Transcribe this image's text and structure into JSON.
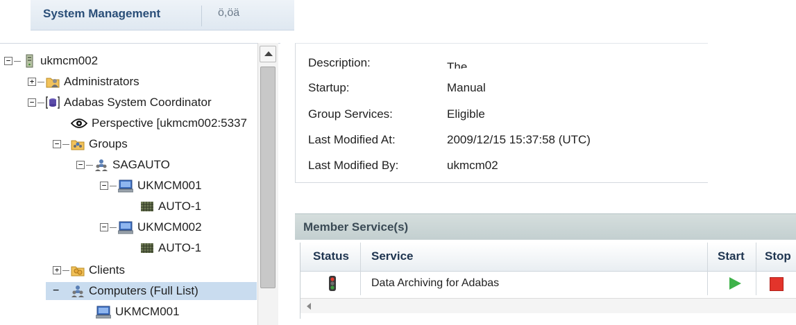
{
  "header": {
    "tab_label": "System Management",
    "tab2_label": "ö,öä"
  },
  "tree": {
    "items": [
      {
        "label": "ukmcm002"
      },
      {
        "label": "Administrators"
      },
      {
        "label": "Adabas System Coordinator"
      },
      {
        "label": "Perspective [ukmcm002:5337"
      },
      {
        "label": "Groups"
      },
      {
        "label": "SAGAUTO"
      },
      {
        "label": "UKMCM001"
      },
      {
        "label": "AUTO-1"
      },
      {
        "label": "UKMCM002"
      },
      {
        "label": "AUTO-1"
      },
      {
        "label": "Clients"
      },
      {
        "label": "Computers (Full List)"
      },
      {
        "label": "UKMCM001"
      }
    ],
    "toggles": {
      "expanded": "−",
      "collapsed": "+"
    }
  },
  "details": {
    "properties": [
      {
        "label": "Description:",
        "value": "The"
      },
      {
        "label": "Startup:",
        "value": "Manual"
      },
      {
        "label": "Group Services:",
        "value": "Eligible"
      },
      {
        "label": "Last Modified At:",
        "value": "2009/12/15 15:37:58 (UTC)"
      },
      {
        "label": "Last Modified By:",
        "value": "ukmcm02"
      }
    ]
  },
  "member_services": {
    "title": "Member Service(s)",
    "columns": {
      "status": "Status",
      "service": "Service",
      "start": "Start",
      "stop": "Stop"
    },
    "rows": [
      {
        "service": "Data Archiving for Adabas"
      }
    ]
  },
  "colors": {
    "selection": "#c9dcef",
    "header_text": "#2a4e78",
    "start_green": "#3fb24a",
    "stop_red": "#e3342b"
  }
}
